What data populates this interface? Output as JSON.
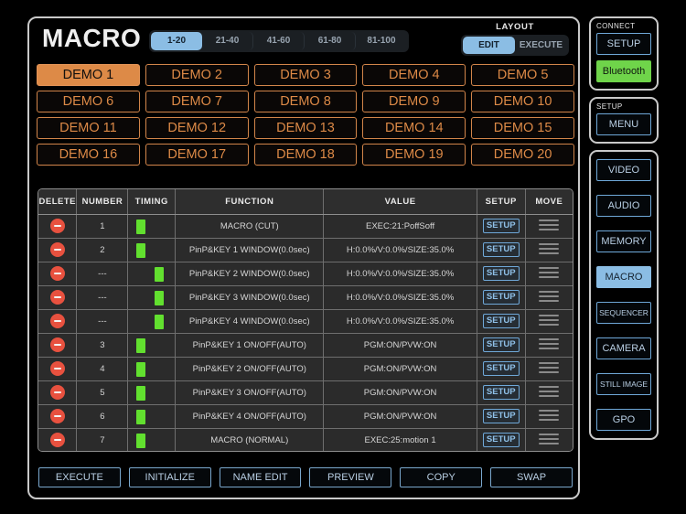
{
  "header": {
    "title": "MACRO",
    "pages": [
      {
        "label": "1-20",
        "selected": true
      },
      {
        "label": "21-40",
        "selected": false
      },
      {
        "label": "41-60",
        "selected": false
      },
      {
        "label": "61-80",
        "selected": false
      },
      {
        "label": "81-100",
        "selected": false
      }
    ],
    "layout_label": "LAYOUT",
    "layout_modes": [
      {
        "label": "EDIT",
        "selected": true
      },
      {
        "label": "EXECUTE",
        "selected": false
      }
    ]
  },
  "demo_buttons": [
    {
      "label": "DEMO 1",
      "selected": true
    },
    {
      "label": "DEMO 2",
      "selected": false
    },
    {
      "label": "DEMO 3",
      "selected": false
    },
    {
      "label": "DEMO 4",
      "selected": false
    },
    {
      "label": "DEMO 5",
      "selected": false
    },
    {
      "label": "DEMO 6",
      "selected": false
    },
    {
      "label": "DEMO 7",
      "selected": false
    },
    {
      "label": "DEMO 8",
      "selected": false
    },
    {
      "label": "DEMO 9",
      "selected": false
    },
    {
      "label": "DEMO 10",
      "selected": false
    },
    {
      "label": "DEMO 11",
      "selected": false
    },
    {
      "label": "DEMO 12",
      "selected": false
    },
    {
      "label": "DEMO 13",
      "selected": false
    },
    {
      "label": "DEMO 14",
      "selected": false
    },
    {
      "label": "DEMO 15",
      "selected": false
    },
    {
      "label": "DEMO 16",
      "selected": false
    },
    {
      "label": "DEMO 17",
      "selected": false
    },
    {
      "label": "DEMO 18",
      "selected": false
    },
    {
      "label": "DEMO 19",
      "selected": false
    },
    {
      "label": "DEMO 20",
      "selected": false
    }
  ],
  "table": {
    "columns": [
      "DELETE",
      "NUMBER",
      "TIMING",
      "FUNCTION",
      "VALUE",
      "SETUP",
      "MOVE"
    ],
    "setup_label": "SETUP",
    "rows": [
      {
        "number": "1",
        "timing": 0,
        "function": "MACRO (CUT)",
        "value": "EXEC:21:PoffSoff"
      },
      {
        "number": "2",
        "timing": 0,
        "function": "PinP&KEY 1 WINDOW(0.0sec)",
        "value": "H:0.0%/V:0.0%/SIZE:35.0%"
      },
      {
        "number": "---",
        "timing": 1,
        "function": "PinP&KEY 2 WINDOW(0.0sec)",
        "value": "H:0.0%/V:0.0%/SIZE:35.0%"
      },
      {
        "number": "---",
        "timing": 1,
        "function": "PinP&KEY 3 WINDOW(0.0sec)",
        "value": "H:0.0%/V:0.0%/SIZE:35.0%"
      },
      {
        "number": "---",
        "timing": 1,
        "function": "PinP&KEY 4 WINDOW(0.0sec)",
        "value": "H:0.0%/V:0.0%/SIZE:35.0%"
      },
      {
        "number": "3",
        "timing": 0,
        "function": "PinP&KEY 1 ON/OFF(AUTO)",
        "value": "PGM:ON/PVW:ON"
      },
      {
        "number": "4",
        "timing": 0,
        "function": "PinP&KEY 2 ON/OFF(AUTO)",
        "value": "PGM:ON/PVW:ON"
      },
      {
        "number": "5",
        "timing": 0,
        "function": "PinP&KEY 3 ON/OFF(AUTO)",
        "value": "PGM:ON/PVW:ON"
      },
      {
        "number": "6",
        "timing": 0,
        "function": "PinP&KEY 4 ON/OFF(AUTO)",
        "value": "PGM:ON/PVW:ON"
      },
      {
        "number": "7",
        "timing": 0,
        "function": "MACRO (NORMAL)",
        "value": "EXEC:25:motion 1"
      }
    ]
  },
  "bottom_buttons": [
    {
      "label": "EXECUTE"
    },
    {
      "label": "INITIALIZE"
    },
    {
      "label": "NAME EDIT"
    },
    {
      "label": "PREVIEW"
    },
    {
      "label": "COPY"
    },
    {
      "label": "SWAP"
    }
  ],
  "rail": {
    "connect": {
      "label": "CONNECT",
      "buttons": [
        {
          "label": "SETUP",
          "state": "normal"
        },
        {
          "label": "Bluetooth",
          "state": "green"
        }
      ]
    },
    "setup": {
      "label": "SETUP",
      "buttons": [
        {
          "label": "MENU",
          "state": "normal"
        }
      ]
    },
    "nav": {
      "buttons": [
        {
          "label": "VIDEO",
          "state": "normal"
        },
        {
          "label": "AUDIO",
          "state": "normal"
        },
        {
          "label": "MEMORY",
          "state": "normal"
        },
        {
          "label": "MACRO",
          "state": "selected"
        },
        {
          "label": "SEQUENCER",
          "state": "tiny"
        },
        {
          "label": "CAMERA",
          "state": "normal"
        },
        {
          "label": "STILL IMAGE",
          "state": "tiny"
        },
        {
          "label": "GPO",
          "state": "normal"
        }
      ]
    }
  },
  "colors": {
    "accent_orange": "#dd8a47",
    "accent_blue": "#8bbde4",
    "status_green": "#6fd44a",
    "timing_green": "#62e02f",
    "delete_red": "#e8513f",
    "panel_border": "#c9c9c9"
  }
}
